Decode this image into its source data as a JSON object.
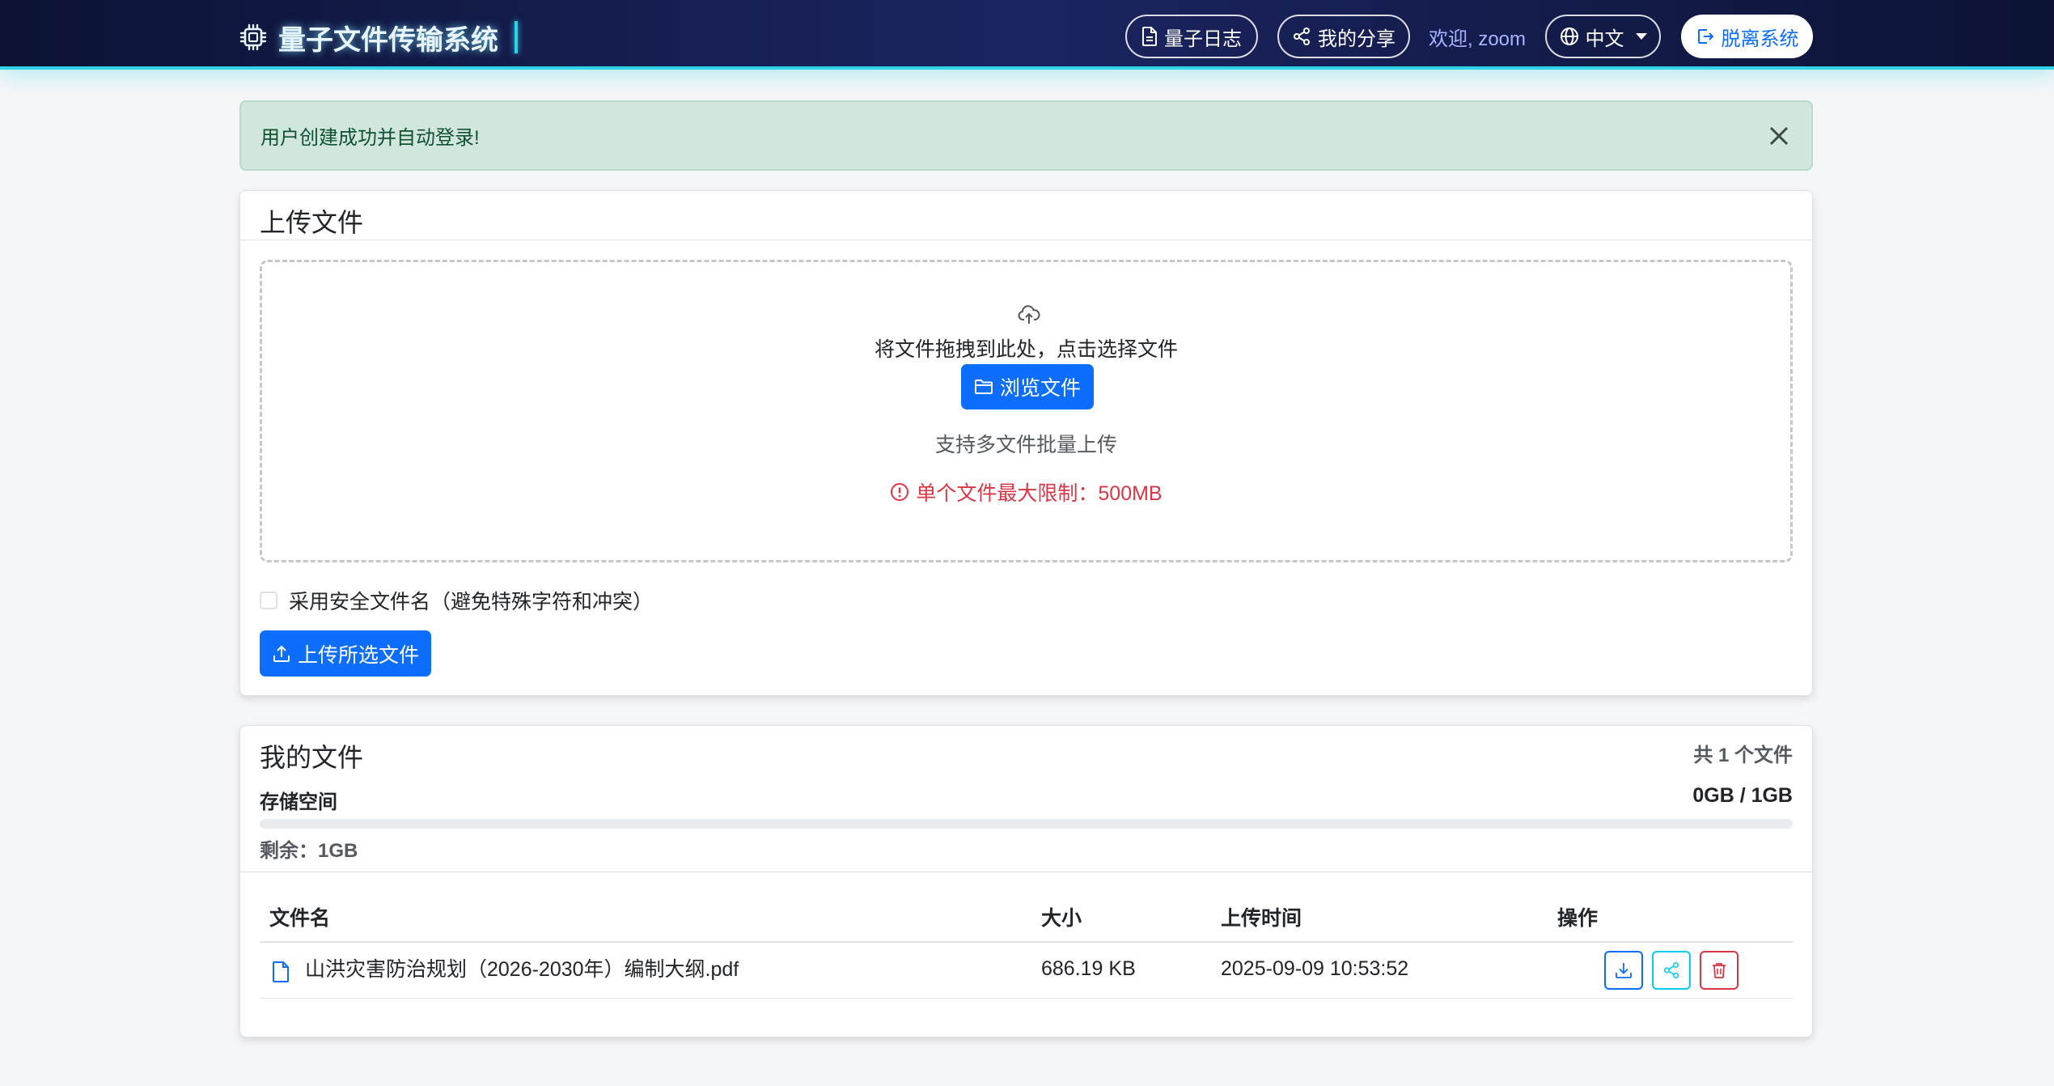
{
  "navbar": {
    "brand": "量子文件传输系统",
    "log_label": "量子日志",
    "share_label": "我的分享",
    "welcome": "欢迎, zoom",
    "language": "中文",
    "logout_label": "脱离系统"
  },
  "alert": {
    "message": "用户创建成功并自动登录!"
  },
  "upload": {
    "title": "上传文件",
    "drop_text": "将文件拖拽到此处，点击选择文件",
    "browse_label": "浏览文件",
    "multi_text": "支持多文件批量上传",
    "limit_text": "单个文件最大限制：500MB",
    "safe_name_label": "采用安全文件名（避免特殊字符和冲突）",
    "upload_button": "上传所选文件"
  },
  "files": {
    "title": "我的文件",
    "count_text": "共 1 个文件",
    "storage_label": "存储空间",
    "storage_value": "0GB / 1GB",
    "storage_used_fraction": 0,
    "remaining_text": "剩余：1GB",
    "columns": {
      "name": "文件名",
      "size": "大小",
      "time": "上传时间",
      "actions": "操作"
    },
    "rows": [
      {
        "name": "山洪灾害防治规划（2026-2030年）编制大纲.pdf",
        "size": "686.19 KB",
        "time": "2025-09-09 10:53:52"
      }
    ]
  },
  "colors": {
    "primary": "#0d6efd",
    "info": "#0dcaf0",
    "danger": "#dc3545",
    "success_bg": "#d1e7dd",
    "navbar_accent": "#2fd3e8"
  }
}
